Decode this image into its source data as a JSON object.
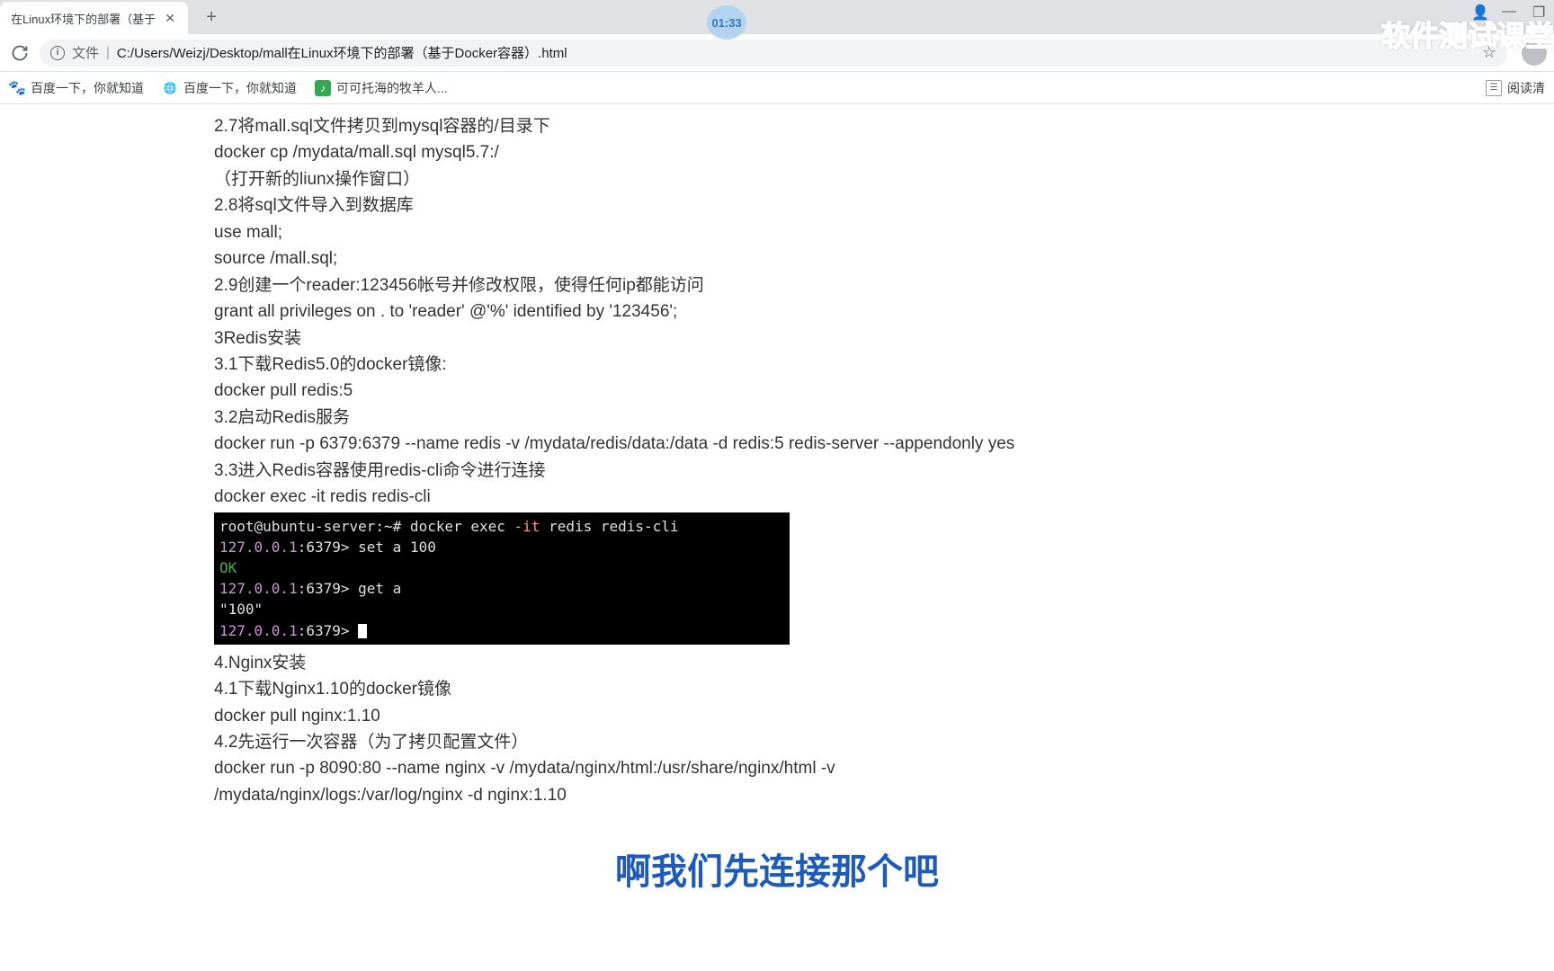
{
  "tab": {
    "title": "在Linux环境下的部署（基于"
  },
  "address": {
    "scheme_label": "文件",
    "path": "C:/Users/Weizj/Desktop/mall在Linux环境下的部署（基于Docker容器）.html"
  },
  "window": {
    "minimize": "—",
    "maximize": "❐",
    "avatar": "👤"
  },
  "bookmarks": {
    "items": [
      {
        "icon": "paw",
        "label": "百度一下，你就知道"
      },
      {
        "icon": "globe",
        "label": "百度一下，你就知道"
      },
      {
        "icon": "green",
        "label": "可可托海的牧羊人..."
      }
    ],
    "reading_list": "阅读清"
  },
  "timer": "01:33",
  "watermark": "软件测试课堂",
  "subtitle": "啊我们先连接那个吧",
  "doc": {
    "l1": "2.7将mall.sql文件拷贝到mysql容器的/目录下",
    "l2": "docker cp /mydata/mall.sql mysql5.7:/",
    "l3": "（打开新的liunx操作窗口）",
    "l4": "2.8将sql文件导入到数据库",
    "l5": "use mall;",
    "l6": "source /mall.sql;",
    "l7": "2.9创建一个reader:123456帐号并修改权限，使得任何ip都能访问",
    "l8": "grant all privileges on . to 'reader' @'%' identified by '123456';",
    "l9": "3Redis安装",
    "l10": "3.1下载Redis5.0的docker镜像:",
    "l11": "docker pull redis:5",
    "l12": "3.2启动Redis服务",
    "l13": "docker run -p 6379:6379 --name redis -v /mydata/redis/data:/data -d redis:5 redis-server --appendonly yes",
    "l14": "3.3进入Redis容器使用redis-cli命令进行连接",
    "l15": "docker exec -it redis redis-cli",
    "l16": "4.Nginx安装",
    "l17": "4.1下载Nginx1.10的docker镜像",
    "l18": "docker pull nginx:1.10",
    "l19": "4.2先运行一次容器（为了拷贝配置文件）",
    "l20": "docker run -p 8090:80 --name nginx -v /mydata/nginx/html:/usr/share/nginx/html -v",
    "l21": "/mydata/nginx/logs:/var/log/nginx -d nginx:1.10"
  },
  "terminal": {
    "prompt_user": "root@ubuntu-server",
    "prompt_path": ":~#",
    "cmd1": " docker exec ",
    "cmd1_opt": "-it",
    "cmd1_rest": " redis redis-cli",
    "ip": "127.0.0.1",
    "port": ":6379> ",
    "cmd2": "set a 100",
    "ok": "OK",
    "cmd3": "get a",
    "result": "\"100\""
  }
}
